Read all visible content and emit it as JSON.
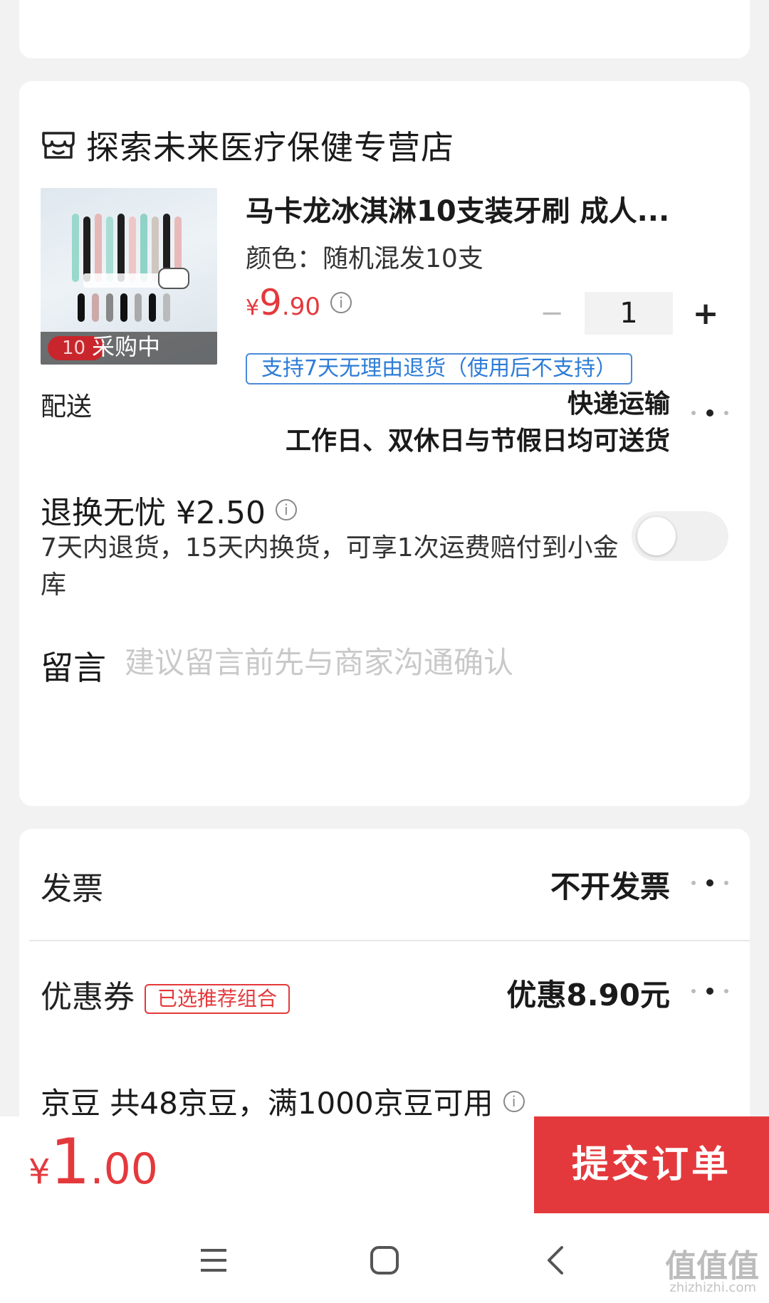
{
  "store": {
    "name": "探索未来医疗保健专营店",
    "icon": "store-icon"
  },
  "product": {
    "title": "马卡龙冰淇淋10支装牙刷 成人...",
    "variant": "颜色：随机混发10支",
    "image_badge_count": "10",
    "image_status": "采购中",
    "price": {
      "currency": "¥",
      "integer": "9",
      "decimal": ".90"
    },
    "price_info_icon": "info-icon",
    "quantity": "1",
    "minus_label": "−",
    "plus_label": "+",
    "return_policy": "支持7天无理由退货（使用后不支持）"
  },
  "delivery": {
    "label": "配送",
    "method": "快递运输",
    "schedule": "工作日、双休日与节假日均可送货"
  },
  "insurance": {
    "title": "退换无忧 ¥2.50",
    "description": "7天内退货，15天内换货，可享1次运费赔付到小金库",
    "enabled": false
  },
  "message": {
    "label": "留言",
    "placeholder": "建议留言前先与商家沟通确认"
  },
  "invoice": {
    "label": "发票",
    "value": "不开发票"
  },
  "coupon": {
    "label": "优惠券",
    "badge": "已选推荐组合",
    "value": "优惠8.90元"
  },
  "beans": {
    "text": "京豆 共48京豆，满1000京豆可用"
  },
  "footer": {
    "total_currency": "¥",
    "total_integer": "1",
    "total_decimal": ".00",
    "submit_label": "提交订单"
  },
  "watermark": {
    "text": "值值值",
    "domain": "zhizhizhi.com"
  },
  "colors": {
    "accent": "#e4393c",
    "link_blue": "#2d7cd6",
    "background": "#f2f2f2"
  }
}
